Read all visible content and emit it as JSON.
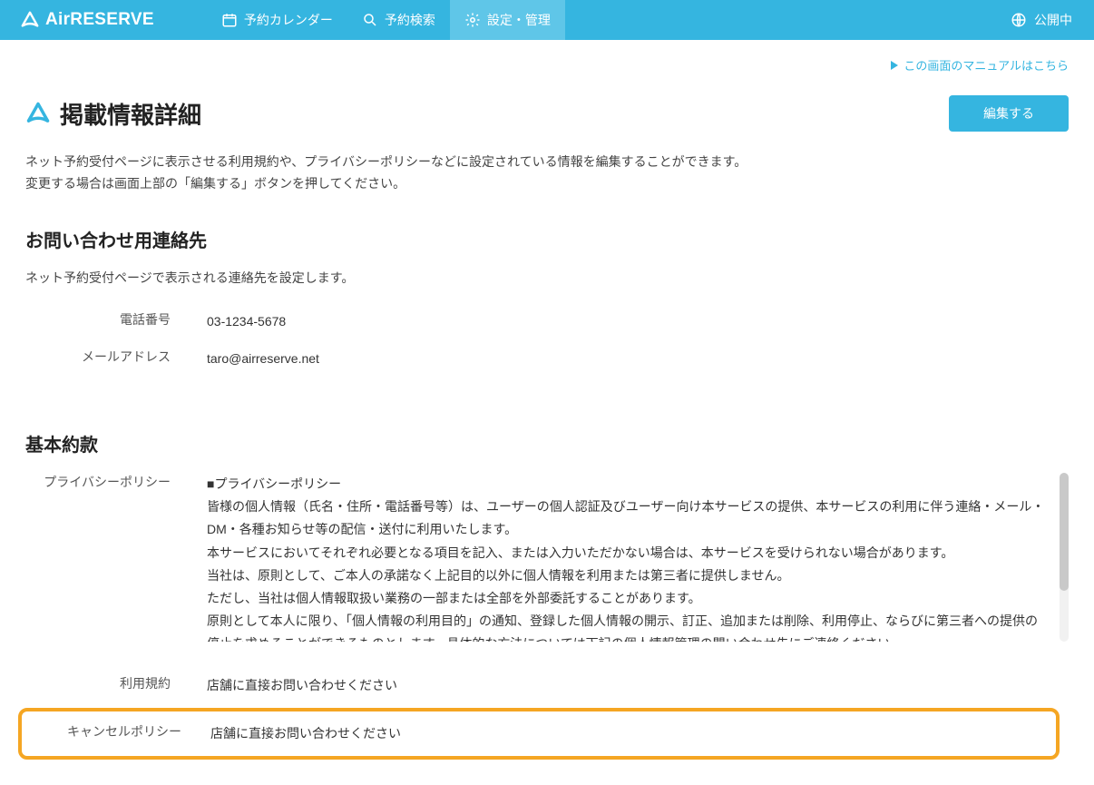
{
  "header": {
    "logo": "AirRESERVE",
    "nav": [
      {
        "label": "予約カレンダー",
        "icon": "calendar"
      },
      {
        "label": "予約検索",
        "icon": "search"
      },
      {
        "label": "設定・管理",
        "icon": "gear",
        "active": true
      }
    ],
    "status_label": "公開中"
  },
  "manual_link": "この画面のマニュアルはこちら",
  "page": {
    "title": "掲載情報詳細",
    "edit_button": "編集する",
    "description_line1": "ネット予約受付ページに表示させる利用規約や、プライバシーポリシーなどに設定されている情報を編集することができます。",
    "description_line2": "変更する場合は画面上部の「編集する」ボタンを押してください。"
  },
  "contact": {
    "heading": "お問い合わせ用連絡先",
    "description": "ネット予約受付ページで表示される連絡先を設定します。",
    "phone_label": "電話番号",
    "phone_value": "03-1234-5678",
    "email_label": "メールアドレス",
    "email_value": "taro@airreserve.net"
  },
  "terms": {
    "heading": "基本約款",
    "privacy_label": "プライバシーポリシー",
    "privacy_body": "■プライバシーポリシー\n皆様の個人情報（氏名・住所・電話番号等）は、ユーザーの個人認証及びユーザー向け本サービスの提供、本サービスの利用に伴う連絡・メール・DM・各種お知らせ等の配信・送付に利用いたします。\n本サービスにおいてそれぞれ必要となる項目を記入、または入力いただかない場合は、本サービスを受けられない場合があります。\n当社は、原則として、ご本人の承諾なく上記目的以外に個人情報を利用または第三者に提供しません。\nただし、当社は個人情報取扱い業務の一部または全部を外部委託することがあります。\n原則として本人に限り、「個人情報の利用目的」の通知、登録した個人情報の開示、訂正、追加または削除、利用停止、ならびに第三者への提供の停止を求めることができるものとします。具体的な方法については下記の個人情報管理の問い合わせ先にご連絡ください。\n\n■個人情報に関するお問い合せ先：",
    "tos_label": "利用規約",
    "tos_value": "店舗に直接お問い合わせください",
    "cancel_label": "キャンセルポリシー",
    "cancel_value": "店舗に直接お問い合わせください"
  }
}
